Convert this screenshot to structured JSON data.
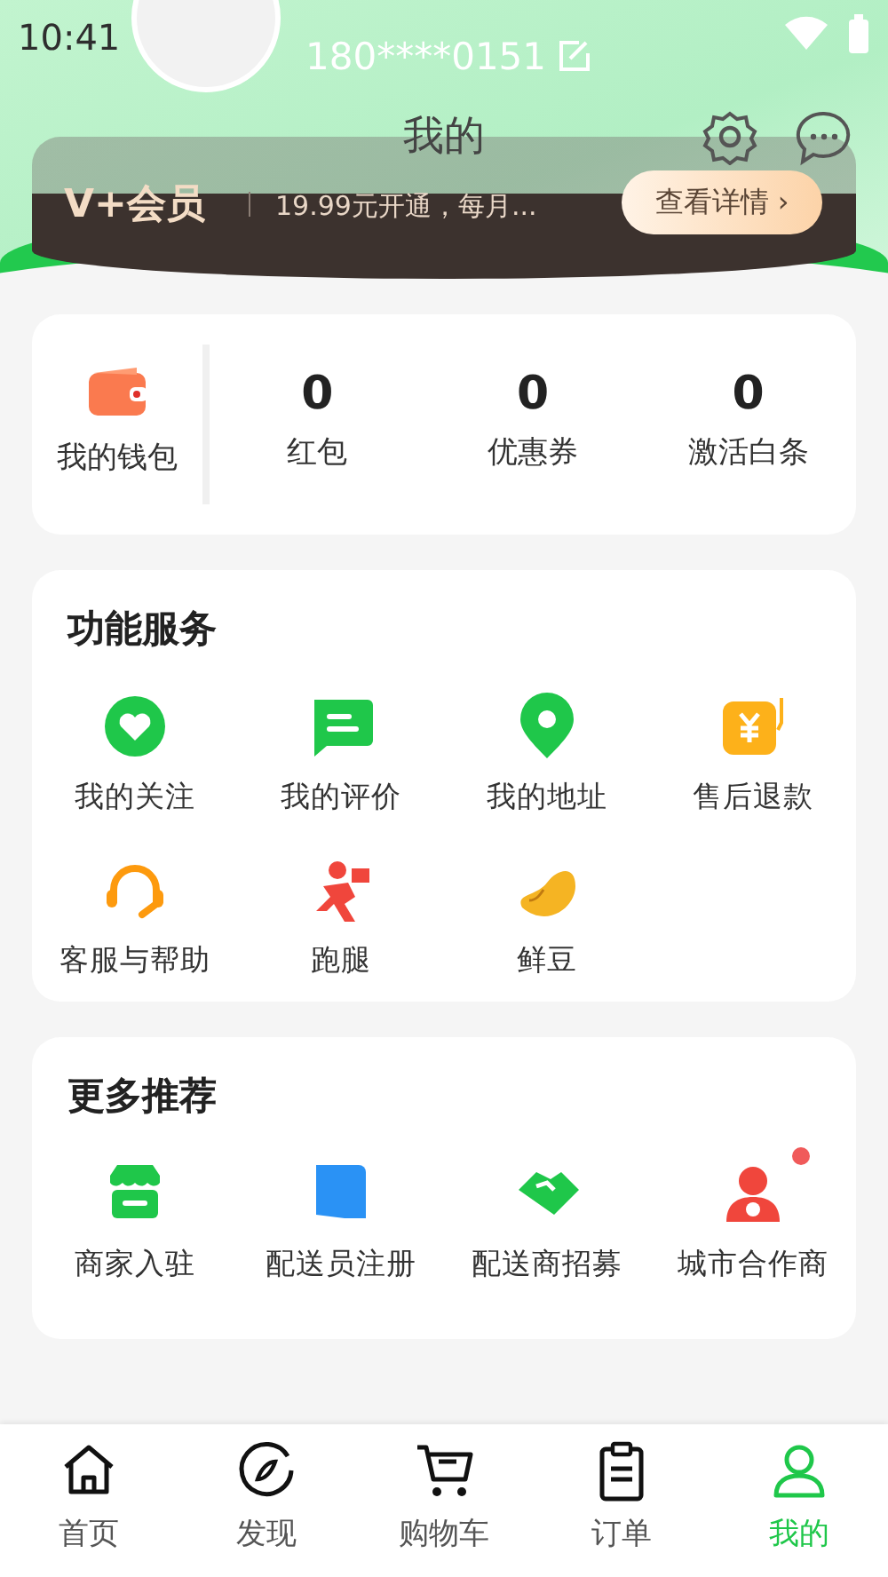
{
  "status_bar": {
    "time": "10:41"
  },
  "header": {
    "title": "我的",
    "phone": "180****0151"
  },
  "vip": {
    "logo": "V+会员",
    "promo": "19.99元开通，每月...",
    "button": "查看详情 ›"
  },
  "wallet": {
    "label": "我的钱包",
    "stats": [
      {
        "value": "0",
        "label": "红包"
      },
      {
        "value": "0",
        "label": "优惠券"
      },
      {
        "value": "0",
        "label": "激活白条"
      }
    ]
  },
  "services": {
    "title": "功能服务",
    "items": [
      {
        "kind": "heart",
        "label": "我的关注"
      },
      {
        "kind": "chat",
        "label": "我的评价"
      },
      {
        "kind": "pin",
        "label": "我的地址"
      },
      {
        "kind": "refund",
        "label": "售后退款"
      },
      {
        "kind": "headset",
        "label": "客服与帮助"
      },
      {
        "kind": "runner",
        "label": "跑腿"
      },
      {
        "kind": "bean",
        "label": "鲜豆"
      }
    ]
  },
  "more": {
    "title": "更多推荐",
    "items": [
      {
        "kind": "store",
        "label": "商家入驻",
        "dot": false
      },
      {
        "kind": "register",
        "label": "配送员注册",
        "dot": false
      },
      {
        "kind": "handshake",
        "label": "配送商招募",
        "dot": false
      },
      {
        "kind": "partner",
        "label": "城市合作商",
        "dot": true
      }
    ]
  },
  "tabbar": [
    {
      "kind": "home",
      "label": "首页",
      "selected": false
    },
    {
      "kind": "compass",
      "label": "发现",
      "selected": false
    },
    {
      "kind": "cart",
      "label": "购物车",
      "selected": false
    },
    {
      "kind": "clipboard",
      "label": "订单",
      "selected": false
    },
    {
      "kind": "person",
      "label": "我的",
      "selected": true
    }
  ]
}
